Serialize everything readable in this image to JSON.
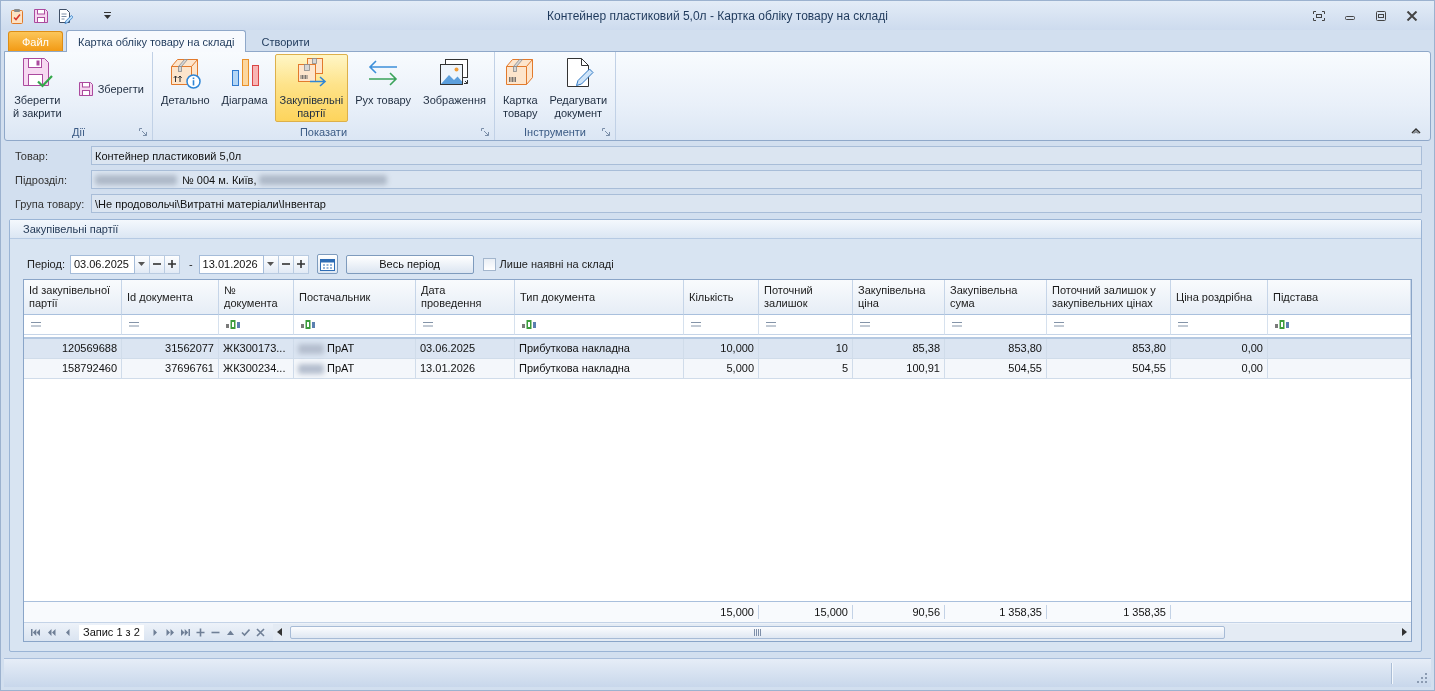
{
  "window": {
    "title": "Контейнер пластиковий 5,0л - Картка обліку товару на складі"
  },
  "ribbon": {
    "tabs": [
      {
        "label": "Файл",
        "kind": "file",
        "selected": false
      },
      {
        "label": "Картка обліку товару на складі",
        "kind": "page",
        "selected": true
      },
      {
        "label": "Створити",
        "kind": "page",
        "selected": false
      }
    ],
    "groups": [
      {
        "title": "Дії",
        "buttons": [
          {
            "label": "Зберегти\nй закрити",
            "kind": "large",
            "selected": false
          },
          {
            "label": "Зберегти",
            "kind": "small",
            "selected": false
          }
        ]
      },
      {
        "title": "Показати",
        "buttons": [
          {
            "label": "Детально",
            "kind": "large",
            "selected": false
          },
          {
            "label": "Діаграма",
            "kind": "large",
            "selected": false
          },
          {
            "label": "Закупівельні\nпартії",
            "kind": "large",
            "selected": true
          },
          {
            "label": "Рух товару",
            "kind": "large",
            "selected": false
          },
          {
            "label": "Зображення",
            "kind": "large",
            "selected": false
          }
        ]
      },
      {
        "title": "Інструменти",
        "buttons": [
          {
            "label": "Картка\nтовару",
            "kind": "large",
            "selected": false
          },
          {
            "label": "Редагувати\nдокумент",
            "kind": "large",
            "selected": false
          }
        ]
      }
    ]
  },
  "fields": [
    {
      "label": "Товар:",
      "value": "Контейнер пластиковий 5,0л"
    },
    {
      "label": "Підрозділ:",
      "value": "№ 004 м. Київ,",
      "blurred_prefix": true,
      "blurred_suffix": true
    },
    {
      "label": "Група товару:",
      "value": "\\Не продовольчі\\Витратні матеріали\\Інвентар"
    }
  ],
  "batches": {
    "title": "Закупівельні партії",
    "period_label": "Період:",
    "date_from": "03.06.2025",
    "range_separator": "-",
    "date_to": "13.01.2026",
    "all_period_button": "Весь період",
    "in_stock_only": {
      "label": "Лише наявні на складі",
      "checked": false
    },
    "table": {
      "columns": [
        {
          "label": "Id закупівельної\nпартії",
          "kind": "number"
        },
        {
          "label": "Id документа",
          "kind": "number"
        },
        {
          "label": "№\nдокумента",
          "kind": "text"
        },
        {
          "label": "Постачальник",
          "kind": "text",
          "blurred_prefix": true
        },
        {
          "label": "Дата\nпроведення",
          "kind": "date"
        },
        {
          "label": "Тип документа",
          "kind": "text"
        },
        {
          "label": "Кількість",
          "kind": "number",
          "total": "15,000"
        },
        {
          "label": "Поточний\nзалишок",
          "kind": "number",
          "total": "15,000"
        },
        {
          "label": "Закупівельна\nціна",
          "kind": "number",
          "total": "90,56"
        },
        {
          "label": "Закупівельна\nсума",
          "kind": "number",
          "total": "1 358,35"
        },
        {
          "label": "Поточний залишок у\nзакупівельних цінах",
          "kind": "number",
          "total": "1 358,35"
        },
        {
          "label": "Ціна роздрібна",
          "kind": "number"
        },
        {
          "label": "Підстава",
          "kind": "text"
        }
      ],
      "rows": [
        {
          "selected": true,
          "cells": [
            "120569688",
            "31562077",
            "ЖК300173...",
            "ПрАТ",
            "03.06.2025",
            "Прибуткова накладна",
            "10,000",
            "10",
            "85,38",
            "853,80",
            "853,80",
            "0,00"
          ]
        },
        {
          "selected": false,
          "cells": [
            "158792460",
            "37696761",
            "ЖК300234...",
            "ПрАТ",
            "13.01.2026",
            "Прибуткова накладна",
            "5,000",
            "5",
            "100,91",
            "504,55",
            "504,55",
            "0,00"
          ]
        }
      ],
      "record_counter": "Запис 1 з 2"
    }
  }
}
